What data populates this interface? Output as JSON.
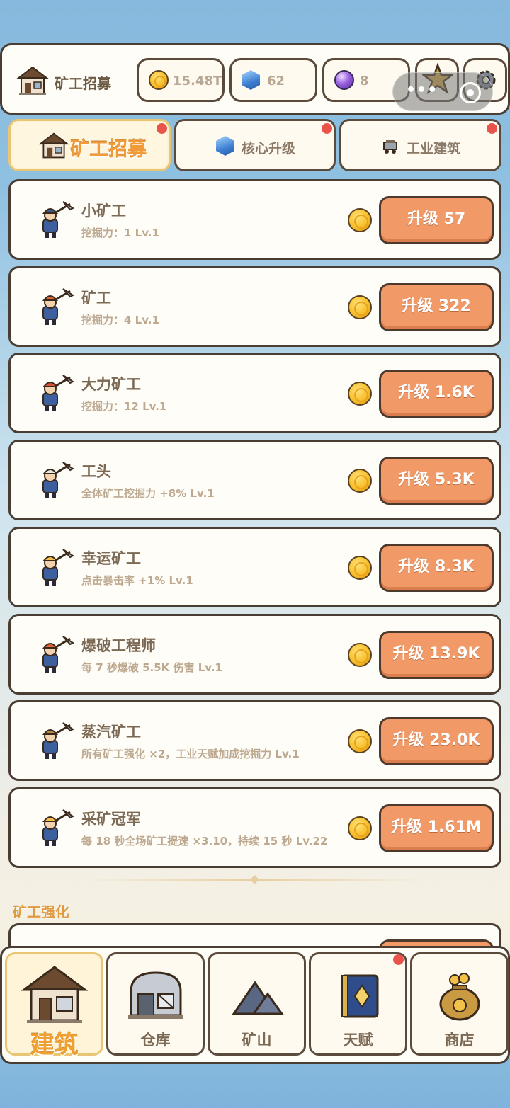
{
  "header": {
    "title": "矿工招募",
    "coins": "15.48T",
    "gems": "62",
    "orbs": "8"
  },
  "tabs": [
    {
      "label": "矿工招募",
      "active": true,
      "badge": true
    },
    {
      "label": "核心升级",
      "active": false,
      "badge": true
    },
    {
      "label": "工业建筑",
      "active": false,
      "badge": true
    }
  ],
  "miners": [
    {
      "name": "小矿工",
      "desc": "挖掘力：1 Lv.1",
      "button": "升级 57",
      "hat": "#3d5a8a"
    },
    {
      "name": "矿工",
      "desc": "挖掘力：4 Lv.1",
      "button": "升级 322",
      "hat": "#e2643a"
    },
    {
      "name": "大力矿工",
      "desc": "挖掘力：12 Lv.1",
      "button": "升级 1.6K",
      "hat": "#d8503a"
    },
    {
      "name": "工头",
      "desc": "全体矿工挖掘力 +8% Lv.1",
      "button": "升级 5.3K",
      "hat": "#e8e8e8"
    },
    {
      "name": "幸运矿工",
      "desc": "点击暴击率 +1% Lv.1",
      "button": "升级 8.3K",
      "hat": "#f2c14a"
    },
    {
      "name": "爆破工程师",
      "desc": "每 7 秒爆破 5.5K 伤害 Lv.1",
      "button": "升级 13.9K",
      "hat": "#e2643a"
    },
    {
      "name": "蒸汽矿工",
      "desc": "所有矿工强化 ×2，工业天赋加成挖掘力 Lv.1",
      "button": "升级 23.0K",
      "hat": "#b28a4a"
    },
    {
      "name": "采矿冠军",
      "desc": "每 18 秒全场矿工提速 ×3.10，持续 15 秒 Lv.22",
      "button": "升级 1.61M",
      "hat": "#f2c14a"
    }
  ],
  "section": {
    "title": "矿工强化"
  },
  "nav": [
    {
      "label": "建筑",
      "active": true,
      "badge": false
    },
    {
      "label": "仓库",
      "active": false,
      "badge": false
    },
    {
      "label": "矿山",
      "active": false,
      "badge": false
    },
    {
      "label": "天赋",
      "active": false,
      "badge": true
    },
    {
      "label": "商店",
      "active": false,
      "badge": false
    }
  ]
}
